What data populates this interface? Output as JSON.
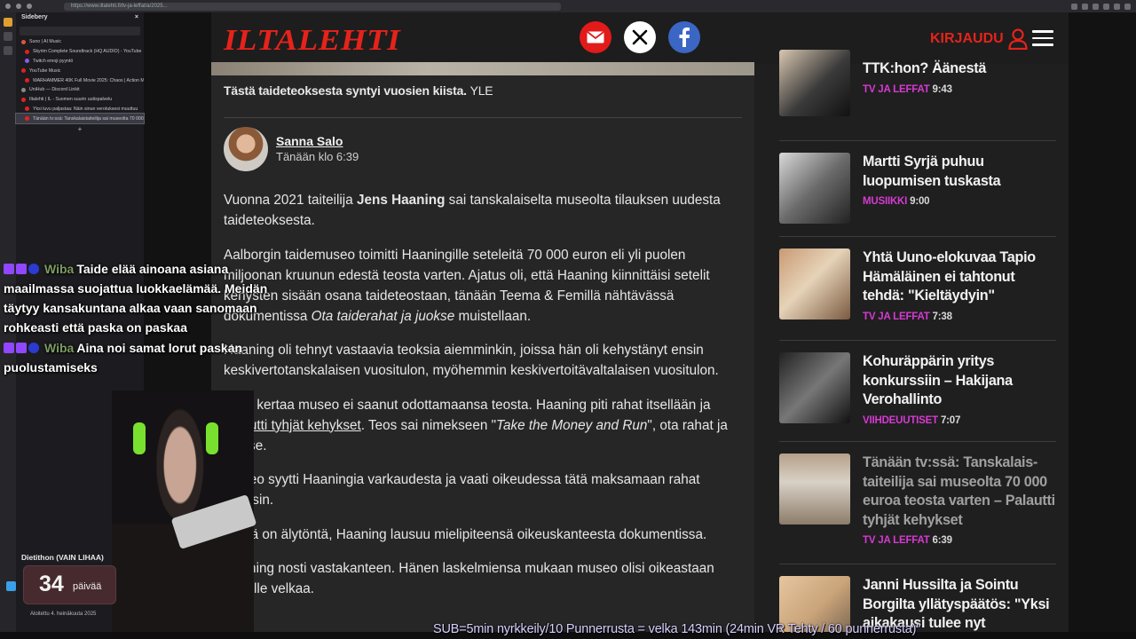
{
  "browser": {
    "url": "https://www.iltalehti.fi/tv-ja-leffat/a/2025..."
  },
  "sidebery": {
    "title": "Sidebery",
    "close_glyph": "×",
    "tabs": [
      {
        "label": "Suno | AI Music",
        "color": "#e0553a",
        "indent": false
      },
      {
        "label": "Skyrim Complete Soundtrack (HQ AUDIO) - YouTube",
        "color": "#e02020",
        "indent": true
      },
      {
        "label": "Twitch emoji pyyntö",
        "color": "#8a5af0",
        "indent": true
      },
      {
        "label": "YouTube Music",
        "color": "#e02020",
        "indent": false
      },
      {
        "label": "WARHAMMER 40K Full Movie 2025: Chaos | Action Movies",
        "color": "#e02020",
        "indent": true
      },
      {
        "label": "UniHub — Discord Linkit",
        "color": "#8a8a8a",
        "indent": false
      },
      {
        "label": "Iltalehti | IL - Suomen suurin uutispalvelu",
        "color": "#e5231b",
        "indent": false
      },
      {
        "label": "Yksi luvu paljastaa: Näin sinun verotuksesi muuttuu",
        "color": "#e5231b",
        "indent": true
      },
      {
        "label": "Tänään tv:ssä: Tanskalaistaiteilija sai museolta 70 000 euro...",
        "color": "#e5231b",
        "indent": true,
        "active": true
      }
    ],
    "new_tab": "+"
  },
  "header": {
    "logo": "ILTALEHTI",
    "login_label": "KIRJAUDU",
    "colors": {
      "brand": "#e5231b"
    }
  },
  "article": {
    "caption": "Tästä taideteoksesta syntyi vuosien kiista.",
    "caption_source": "YLE",
    "author": "Sanna Salo",
    "published": "Tänään klo 6:39",
    "p1_before": "Vuonna 2021 taiteilija ",
    "p1_bold": "Jens Haaning",
    "p1_after": " sai tanskalaiselta museolta tilauksen uudesta taideteoksesta.",
    "p2_before": "Aalborgin taidemuseo toimitti Haaningille seteleitä 70 000 euron eli yli puolen miljoonan kruunun edestä teosta varten. Ajatus oli, että Haaning kiinnittäisi setelit kehysten sisään osana taideteostaan, tänään Teema & Femillä nähtävässä dokumentissa ",
    "p2_italic": "Ota taiderahat ja juokse",
    "p2_after": " muistellaan.",
    "p3": "Haaning oli tehnyt vastaavia teoksia aiemminkin, joissa hän oli kehystänyt ensin keskivertotanskalaisen vuositulon, myöhemmin keskivertoitävaltalaisen vuositulon.",
    "p4_before": "Tällä kertaa museo ei saanut odottamaansa teosta. Haaning piti rahat itsellään ja ",
    "p4_link": "palautti tyhjät kehykset",
    "p4_mid": ". Teos sai nimekseen \"",
    "p4_italic": "Take the Money and Run",
    "p4_after": "\", ota rahat ja juokse.",
    "p5": "Museo syytti Haaningia varkaudesta ja vaati oikeudessa tätä maksamaan rahat takaisin.",
    "p6": "Tämä on älytöntä, Haaning lausuu mielipiteensä oikeuskanteesta dokumentissa.",
    "p7": "Haaning nosti vastakanteen. Hänen laskelmiensa mukaan museo olisi oikeastaan hänelle velkaa."
  },
  "sidebar": {
    "colors": {
      "category": "#d63ad2"
    },
    "items": [
      {
        "title": "TTK:hon? Äänestä",
        "category": "TV JA LEFFAT",
        "time": "9:43",
        "dim": false
      },
      {
        "title": "Martti Syrjä puhuu luopumisen tuskasta",
        "category": "MUSIIKKI",
        "time": "9:00",
        "dim": false
      },
      {
        "title": "Yhtä Uuno-elokuvaa Tapio Hämäläinen ei tahtonut tehdä: \"Kieltäydyin\"",
        "category": "TV JA LEFFAT",
        "time": "7:38",
        "dim": false
      },
      {
        "title": "Kohuräppärin yritys konkurssiin – Hakijana Verohallinto",
        "category": "VIIHDEUUTISET",
        "time": "7:07",
        "dim": false
      },
      {
        "title": "Tänään tv:ssä: Tanskalais-taiteilija sai museolta 70 000 euroa teosta varten – Palautti tyhjät kehykset",
        "category": "TV JA LEFFAT",
        "time": "6:39",
        "dim": true
      },
      {
        "title": "Janni Hussilta ja Sointu Borgilta yllätyspäätös: \"Yksi aikakausi tulee nyt",
        "category": "",
        "time": "",
        "dim": false
      }
    ]
  },
  "stream": {
    "chat": [
      {
        "user": "Wiba",
        "text": "Taide elää ainoana asiana maailmassa suojattua luokkaelämää. Meidän täytyy kansakuntana alkaa vaan sanomaan rohkeasti että paska on paskaa"
      },
      {
        "user": "Wiba",
        "text": "Aina noi samat lorut paskan puolustamiseks"
      }
    ],
    "sub_goal_label": "Dietithon (VAIN LIHAA)",
    "sub_goal_count": "34",
    "sub_goal_unit": "päivää",
    "sub_goal_since": "Aloitettu 4. heinäkuuta 2025",
    "ticker": "SUB=5min nyrkkeily/10 Punnerrusta = velka 143min (24min VR Tehty / 60 punnerrusta)\""
  }
}
